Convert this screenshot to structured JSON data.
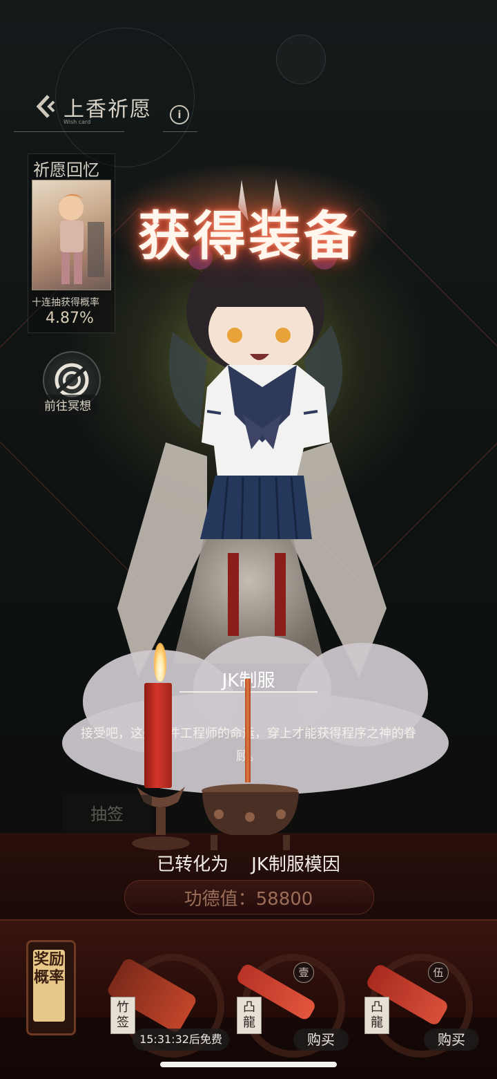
{
  "header": {
    "title": "上香祈愿",
    "subtitle": "Wish card"
  },
  "memory": {
    "title": "祈愿回忆",
    "rate_label": "十连抽获得概率",
    "rate_value": "4.87%",
    "meditate_label": "前往冥想"
  },
  "reveal": {
    "heading": "获得装备",
    "item_name": "JK制服",
    "item_description": "接受吧，这是软件工程师的命运，穿上才能获得程序之神的眷顾。",
    "converted_prefix": "已转化为",
    "converted_item": "JK制服模因",
    "draw_hint": "抽签"
  },
  "footer": {
    "merit_label": "功德值：",
    "merit_value": "58800",
    "reward_button": "奖励概率",
    "slots": [
      {
        "tag": "竹签",
        "timer": "15:31:32后免费",
        "badge": ""
      },
      {
        "tag": "凸龍",
        "buy_label": "购买",
        "badge": "壹"
      },
      {
        "tag": "凸龍",
        "buy_label": "购买",
        "badge": "伍"
      }
    ]
  },
  "colors": {
    "heading_glow": "#e0503a",
    "candle": "#d3362a",
    "floor": "#2a0f0b"
  }
}
